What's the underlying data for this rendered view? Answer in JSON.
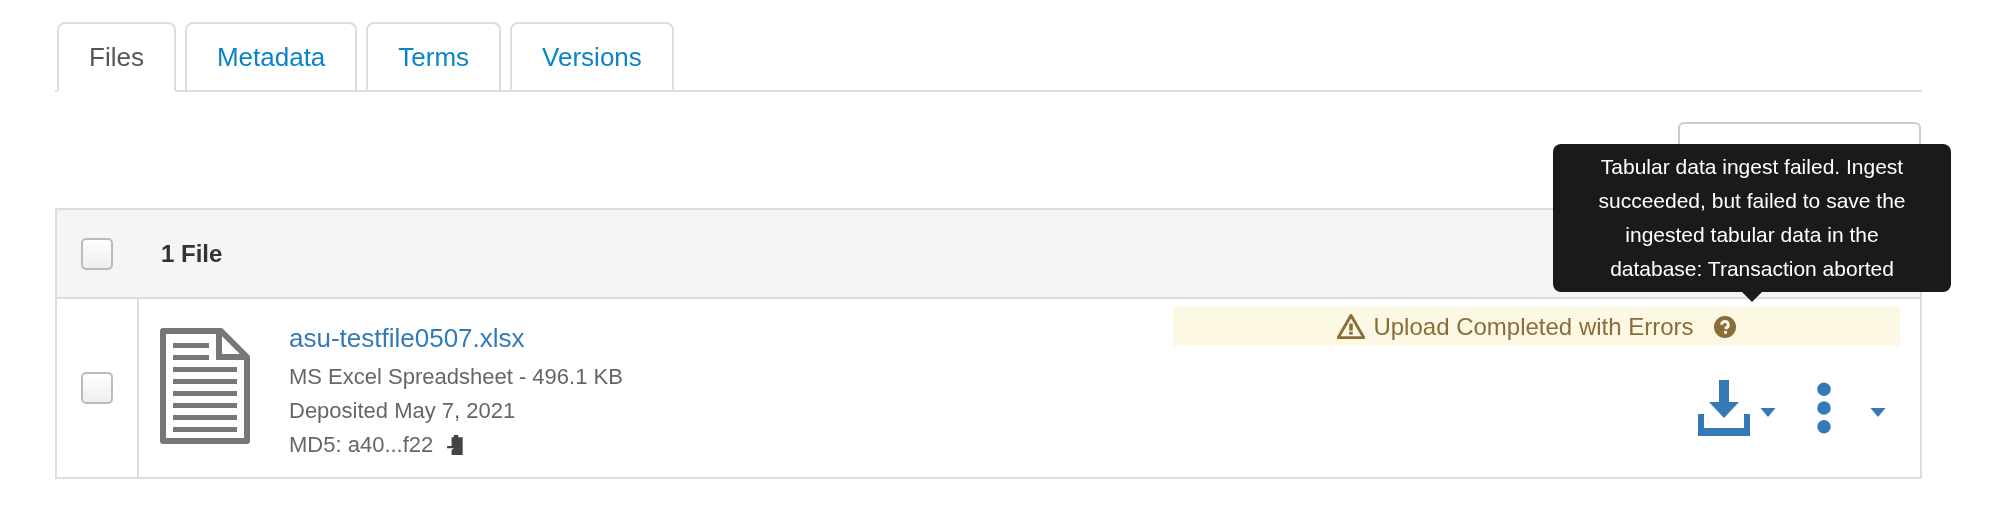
{
  "tabs": [
    {
      "label": "Files",
      "selected": true
    },
    {
      "label": "Metadata",
      "selected": false
    },
    {
      "label": "Terms",
      "selected": false
    },
    {
      "label": "Versions",
      "selected": false
    }
  ],
  "table": {
    "header": {
      "checked": false,
      "count": "1 File"
    },
    "files": [
      {
        "checked": false,
        "name": "asu-testfile0507.xlsx",
        "type_size": "MS Excel Spreadsheet - 496.1 KB",
        "deposited": "Deposited May 7, 2021",
        "md5": "MD5: a40...f22",
        "status": "Upload Completed with Errors"
      }
    ]
  },
  "tooltip": {
    "text": "Tabular data ingest failed. Ingest succeeded, but failed to save the ingested tabular data in the database: Transaction aborted"
  }
}
